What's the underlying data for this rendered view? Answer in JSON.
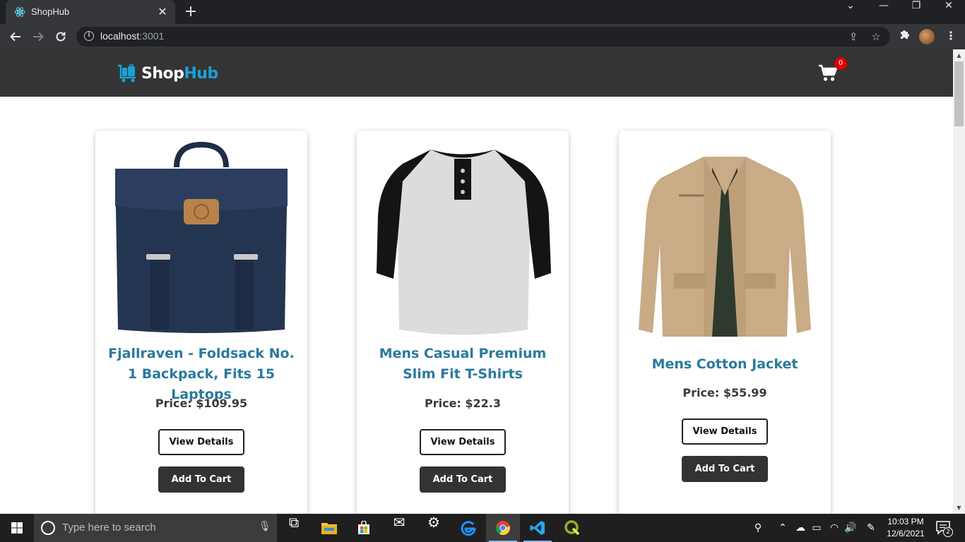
{
  "browser": {
    "tab_title": "ShopHub",
    "tab_close": "✕",
    "new_tab": "+",
    "url_host": "localhost",
    "url_port": ":3001",
    "window_controls": {
      "dropdown": "⌄",
      "minimize": "—",
      "restore": "❐",
      "close": "✕"
    }
  },
  "site": {
    "logo_part1": "Shop",
    "logo_part2": "Hub",
    "cart_count": "0",
    "brand_color": "#1aa2d6",
    "header_color": "#343434"
  },
  "products": [
    {
      "title": "Fjallraven - Foldsack No. 1 Backpack, Fits 15 Laptops",
      "price": "Price: $109.95",
      "view_label": "View Details",
      "cart_label": "Add To Cart",
      "image": "navy-backpack"
    },
    {
      "title": "Mens Casual Premium Slim Fit T-Shirts",
      "price": "Price: $22.3",
      "view_label": "View Details",
      "cart_label": "Add To Cart",
      "image": "raglan-tshirt"
    },
    {
      "title": "Mens Cotton Jacket",
      "price": "Price: $55.99",
      "view_label": "View Details",
      "cart_label": "Add To Cart",
      "image": "khaki-jacket"
    }
  ],
  "taskbar": {
    "search_placeholder": "Type here to search",
    "time": "10:03 PM",
    "date": "12/6/2021",
    "notification_count": "2"
  }
}
